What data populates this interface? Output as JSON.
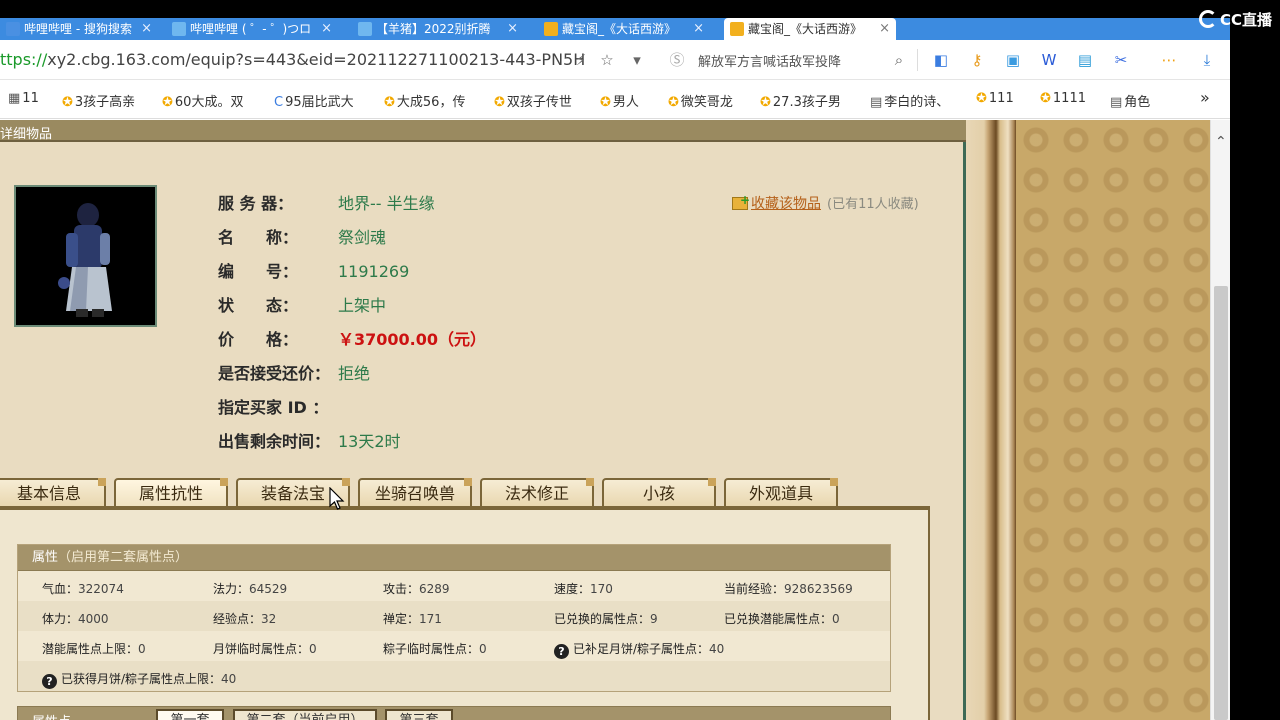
{
  "overlay": {
    "brand": "CC直播"
  },
  "browser": {
    "tabs": [
      {
        "label": "哔哩哔哩 - 搜狗搜索",
        "icon": "sogou-icon",
        "color": "#4a90e2"
      },
      {
        "label": "哔哩哔哩 ( ゜- ゜)つロ",
        "icon": "bilibili-icon",
        "color": "#6fb7ef"
      },
      {
        "label": "【羊猪】2022别折腾",
        "icon": "bilibili-icon",
        "color": "#6fb7ef"
      },
      {
        "label": "藏宝阁_《大话西游》",
        "icon": "cbg-icon",
        "color": "#f2b01e"
      },
      {
        "label": "藏宝阁_《大话西游》",
        "icon": "cbg-icon",
        "color": "#f2b01e"
      }
    ],
    "url_scheme": "ttps://",
    "url_rest": "xy2.cbg.163.com/equip?s=443&eid=202112271100213-443-PN5H",
    "search_hint": "解放军方言喊话敌军投降",
    "bookmarks": [
      {
        "label": "11",
        "icon": "page-icon"
      },
      {
        "label": "3孩子高亲",
        "icon": "star-icon"
      },
      {
        "label": "60大成。双",
        "icon": "star-icon"
      },
      {
        "label": "95届比武大",
        "icon": "c-icon"
      },
      {
        "label": "大成56，传",
        "icon": "star-icon"
      },
      {
        "label": "双孩子传世",
        "icon": "star-icon"
      },
      {
        "label": "男人",
        "icon": "star-icon"
      },
      {
        "label": "微笑哥龙",
        "icon": "star-icon"
      },
      {
        "label": "27.3孩子男",
        "icon": "star-icon"
      },
      {
        "label": "李白的诗、",
        "icon": "doc-icon"
      },
      {
        "label": "111",
        "icon": "star-icon"
      },
      {
        "label": "1111",
        "icon": "star-icon"
      },
      {
        "label": "角色",
        "icon": "doc-icon"
      }
    ],
    "bookmarks_more": "»"
  },
  "page": {
    "section_title": "详细物品",
    "item": {
      "server_label": "服 务 器：",
      "server_value": "地界-- 半生缘",
      "name_label": "名　　称：",
      "name_value": "祭剑魂",
      "id_label": "编　　号：",
      "id_value": "1191269",
      "status_label": "状　　态：",
      "status_value": "上架中",
      "price_label": "价　　格：",
      "price_value": "￥37000.00（元）",
      "bargain_label": "是否接受还价：",
      "bargain_value": "拒绝",
      "buyer_label": "指定买家 ID ：",
      "buyer_value": "",
      "remain_label": "出售剩余时间：",
      "remain_value": "13天2时"
    },
    "favorite": {
      "link": "收藏该物品",
      "count": "(已有11人收藏)"
    },
    "tabs": [
      "基本信息",
      "属性抗性",
      "装备法宝",
      "坐骑召唤兽",
      "法术修正",
      "小孩",
      "外观道具"
    ],
    "active_tab": 1,
    "attributes": {
      "title": "属性",
      "subtitle": "（启用第二套属性点）",
      "rows": [
        [
          [
            "气血：",
            "322074"
          ],
          [
            "法力：",
            "64529"
          ],
          [
            "攻击：",
            "6289"
          ],
          [
            "速度：",
            "170"
          ],
          [
            "当前经验：",
            "928623569"
          ]
        ],
        [
          [
            "体力：",
            "4000"
          ],
          [
            "经验点：",
            "32"
          ],
          [
            "禅定：",
            "171"
          ],
          [
            "已兑换的属性点：",
            "9"
          ],
          [
            "已兑换潜能属性点：",
            "0"
          ]
        ],
        [
          [
            "潜能属性点上限：",
            "0"
          ],
          [
            "月饼临时属性点：",
            "0"
          ],
          [
            "粽子临时属性点：",
            "0"
          ],
          [
            "已补足月饼/粽子属性点：",
            "40"
          ]
        ],
        [
          [
            "已获得月饼/粽子属性点上限：",
            "40"
          ]
        ]
      ]
    },
    "points": {
      "title": "属性点",
      "subtabs": [
        "第一套",
        "第二套（当前启用）",
        "第三套"
      ]
    }
  }
}
